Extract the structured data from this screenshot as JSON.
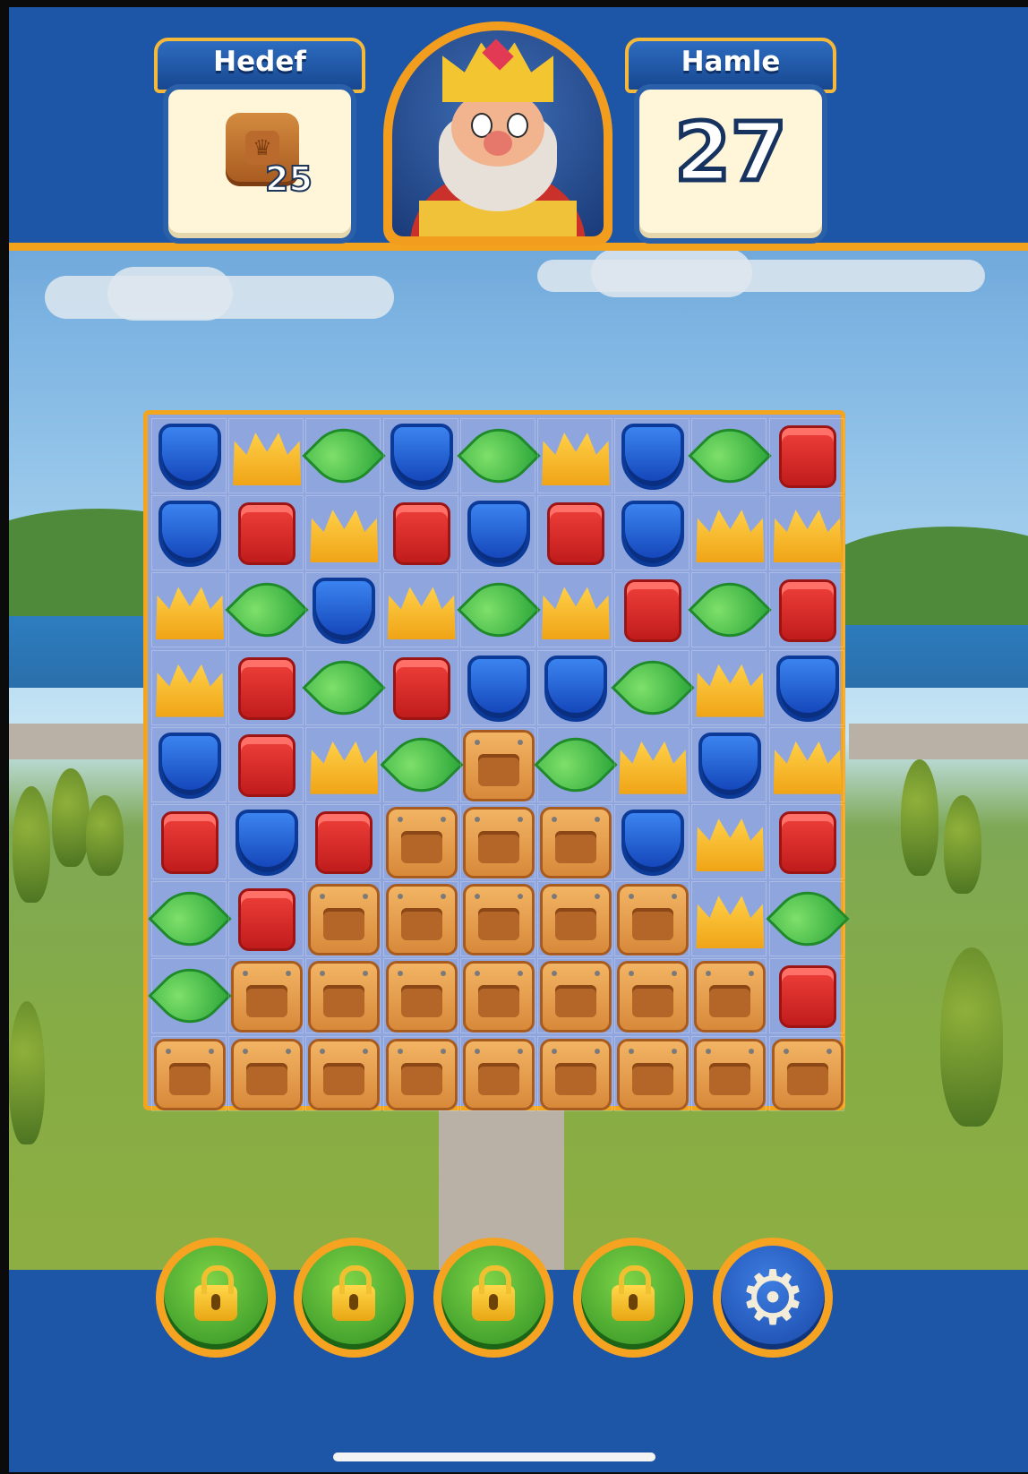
{
  "header": {
    "goal_title": "Hedef",
    "goal_count": "25",
    "goal_item_icon": "wooden-box-icon",
    "moves_title": "Hamle",
    "moves_count": "27"
  },
  "board": {
    "columns": 9,
    "rows": 9,
    "legend": {
      "S": "blue-shield",
      "C": "yellow-crown",
      "L": "green-leaf",
      "B": "red-book",
      "W": "wooden-box"
    },
    "grid": [
      [
        "S",
        "C",
        "L",
        "S",
        "L",
        "C",
        "S",
        "L",
        "B"
      ],
      [
        "S",
        "B",
        "C",
        "B",
        "S",
        "B",
        "S",
        "C",
        "C"
      ],
      [
        "C",
        "L",
        "S",
        "C",
        "L",
        "C",
        "B",
        "L",
        "B"
      ],
      [
        "C",
        "B",
        "L",
        "B",
        "S",
        "S",
        "L",
        "C",
        "S"
      ],
      [
        "S",
        "B",
        "C",
        "L",
        "W",
        "L",
        "C",
        "S",
        "C"
      ],
      [
        "B",
        "S",
        "B",
        "W",
        "W",
        "W",
        "S",
        "C",
        "B"
      ],
      [
        "L",
        "B",
        "W",
        "W",
        "W",
        "W",
        "W",
        "C",
        "L"
      ],
      [
        "L",
        "W",
        "W",
        "W",
        "W",
        "W",
        "W",
        "W",
        "B"
      ],
      [
        "W",
        "W",
        "W",
        "W",
        "W",
        "W",
        "W",
        "W",
        "W"
      ]
    ]
  },
  "footer": {
    "boosters": [
      "lock-icon",
      "lock-icon",
      "lock-icon",
      "lock-icon"
    ],
    "settings_icon": "gear-icon"
  },
  "colors": {
    "header_blue": "#1d56a6",
    "accent_orange": "#f3a51e",
    "cream": "#fff5d9"
  }
}
